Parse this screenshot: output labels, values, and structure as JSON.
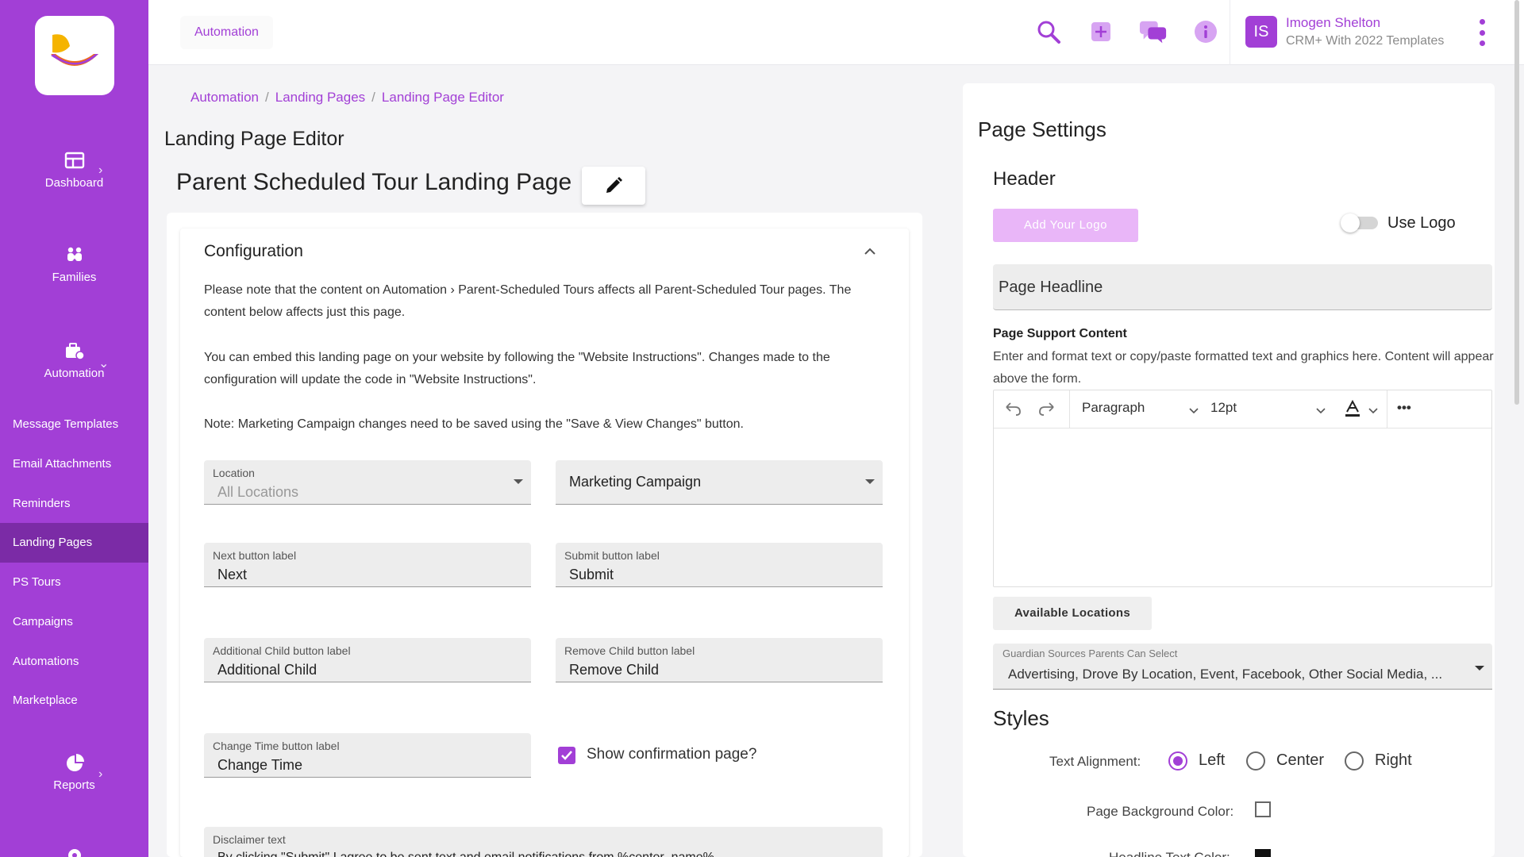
{
  "sidebar": {
    "main": [
      {
        "label": "Dashboard",
        "icon": "dashboard-icon"
      },
      {
        "label": "Families",
        "icon": "families-icon"
      },
      {
        "label": "Automation",
        "icon": "automation-icon"
      },
      {
        "label": "Reports",
        "icon": "reports-icon"
      }
    ],
    "items": [
      {
        "label": "Message Templates"
      },
      {
        "label": "Email Attachments"
      },
      {
        "label": "Reminders"
      },
      {
        "label": "Landing Pages",
        "active": true
      },
      {
        "label": "PS Tours"
      },
      {
        "label": "Campaigns"
      },
      {
        "label": "Automations"
      },
      {
        "label": "Marketplace"
      }
    ]
  },
  "topbar": {
    "tab": "Automation",
    "icons": [
      "search-icon",
      "add-icon",
      "chat-icon",
      "info-icon"
    ],
    "user": {
      "initials": "IS",
      "name": "Imogen Shelton",
      "subtitle": "CRM+ With 2022 Templates"
    }
  },
  "breadcrumb": [
    "Automation",
    "Landing Pages",
    "Landing Page Editor"
  ],
  "page_title": "Landing Page Editor",
  "landing_page_name": "Parent Scheduled Tour Landing Page",
  "config": {
    "title": "Configuration",
    "paragraphs": [
      "Please note that the content on Automation › Parent-Scheduled Tours affects all Parent-Scheduled Tour pages. The content below affects just this page.",
      "You can embed this landing page on your website by following the \"Website Instructions\". Changes made to the configuration will update the code in \"Website Instructions\".",
      "Note: Marketing Campaign changes need to be saved using the \"Save & View Changes\" button."
    ],
    "location": {
      "label": "Location",
      "value": "All Locations"
    },
    "campaign": {
      "value": "Marketing Campaign"
    },
    "next_label": {
      "label": "Next button label",
      "value": "Next"
    },
    "submit_label": {
      "label": "Submit button label",
      "value": "Submit"
    },
    "add_child": {
      "label": "Additional Child button label",
      "value": "Additional Child"
    },
    "remove_child": {
      "label": "Remove Child button label",
      "value": "Remove Child"
    },
    "change_time": {
      "label": "Change Time button label",
      "value": "Change Time"
    },
    "show_confirmation": {
      "label": "Show confirmation page?",
      "checked": true
    },
    "disclaimer": {
      "label": "Disclaimer text",
      "value": "By clicking \"Submit\" I agree to be sent text and email notifications from %center_name%"
    }
  },
  "settings": {
    "title": "Page Settings",
    "header_title": "Header",
    "add_logo": "Add Your Logo",
    "use_logo": "Use Logo",
    "headline": "Page Headline",
    "support_title": "Page Support Content",
    "support_desc": "Enter and format text or copy/paste formatted text and graphics here. Content will appear above the form.",
    "editor": {
      "block": "Paragraph",
      "size": "12pt",
      "more": "•••"
    },
    "available_locations": "Available Locations",
    "sources": {
      "label": "Guardian Sources Parents Can Select",
      "value": "Advertising, Drove By Location, Event, Facebook, Other Social Media, ..."
    },
    "styles_title": "Styles",
    "text_alignment_label": "Text Alignment:",
    "alignments": [
      "Left",
      "Center",
      "Right"
    ],
    "alignment_selected": "Left",
    "bg_color_label": "Page Background Color:",
    "headline_color_label": "Headline Text Color:"
  },
  "colors": {
    "brand": "#a23fd6",
    "brand_dark": "#7b2ba6"
  }
}
